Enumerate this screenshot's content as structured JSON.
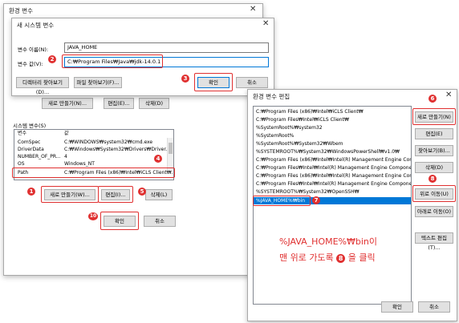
{
  "env_dialog": {
    "title": "환경 변수",
    "close": "✕",
    "system_vars_label": "시스템 변수(S)",
    "col_var": "변수",
    "col_val": "값",
    "rows": [
      {
        "name": "ComSpec",
        "value": "C:₩WINDOWS₩system32₩cmd.exe"
      },
      {
        "name": "DriverData",
        "value": "C:₩Windows₩System32₩Drivers₩Driver..."
      },
      {
        "name": "NUMBER_OF_PR...",
        "value": "4"
      },
      {
        "name": "OS",
        "value": "Windows_NT"
      },
      {
        "name": "Path",
        "value": "C:₩Program Files (x86)₩Intel₩iCLS Client₩..."
      }
    ],
    "user_buttons": {
      "new": "새로 만들기(N)...",
      "edit": "편집(E)...",
      "delete": "삭제(D)"
    },
    "sys_buttons": {
      "new": "새로 만들기(W)...",
      "edit": "편집(I)...",
      "delete": "삭제(L)"
    },
    "ok": "확인",
    "cancel": "취소"
  },
  "new_var_dialog": {
    "title": "새 시스템 변수",
    "close": "✕",
    "name_label": "변수 이름(N):",
    "name_value": "JAVA_HOME",
    "value_label": "변수 값(V):",
    "value_value": "C:₩Program Files₩Java₩jdk-14.0.1",
    "browse_dir": "디렉터리 찾아보기(D)...",
    "browse_file": "파일 찾아보기(F)...",
    "ok": "확인",
    "cancel": "취소"
  },
  "edit_dialog": {
    "title": "환경 변수 편집",
    "close": "✕",
    "entries": [
      "C:₩Program Files (x86)₩Intel₩iCLS Client₩",
      "C:₩Program Files₩Intel₩iCLS Client₩",
      "%SystemRoot%₩system32",
      "%SystemRoot%",
      "%SystemRoot%₩System32₩Wbem",
      "%SYSTEMROOT%₩System32₩WindowsPowerShell₩v1.0₩",
      "C:₩Program Files (x86)₩Intel₩Intel(R) Management Engine Component...",
      "C:₩Program Files₩Intel₩Intel(R) Management Engine Component...",
      "C:₩Program Files (x86)₩Intel₩Intel(R) Management Engine Component...",
      "C:₩Program Files₩Intel₩Intel(R) Management Engine Component...",
      "%SYSTEMROOT%₩System32₩OpenSSH₩",
      "%JAVA_HOME%₩bin"
    ],
    "buttons": {
      "new": "새로 만들기(N)",
      "edit": "편집(E)",
      "browse": "찾아보기(B)...",
      "delete": "삭제(D)",
      "move_up": "위로 이동(U)",
      "move_down": "아래로 이동(O)",
      "edit_text": "텍스트 편집(T)..."
    },
    "annotation_line1": "%JAVA_HOME%₩bin이",
    "annotation_line2_a": "맨 위로 가도록",
    "annotation_line2_b": "을 클릭",
    "annotation_num": "8",
    "ok": "확인",
    "cancel": "취소"
  },
  "markers": [
    "1",
    "2",
    "3",
    "4",
    "5",
    "6",
    "7",
    "8",
    "10"
  ],
  "colors": {
    "accent": "#e03030",
    "selection": "#0078d7"
  }
}
